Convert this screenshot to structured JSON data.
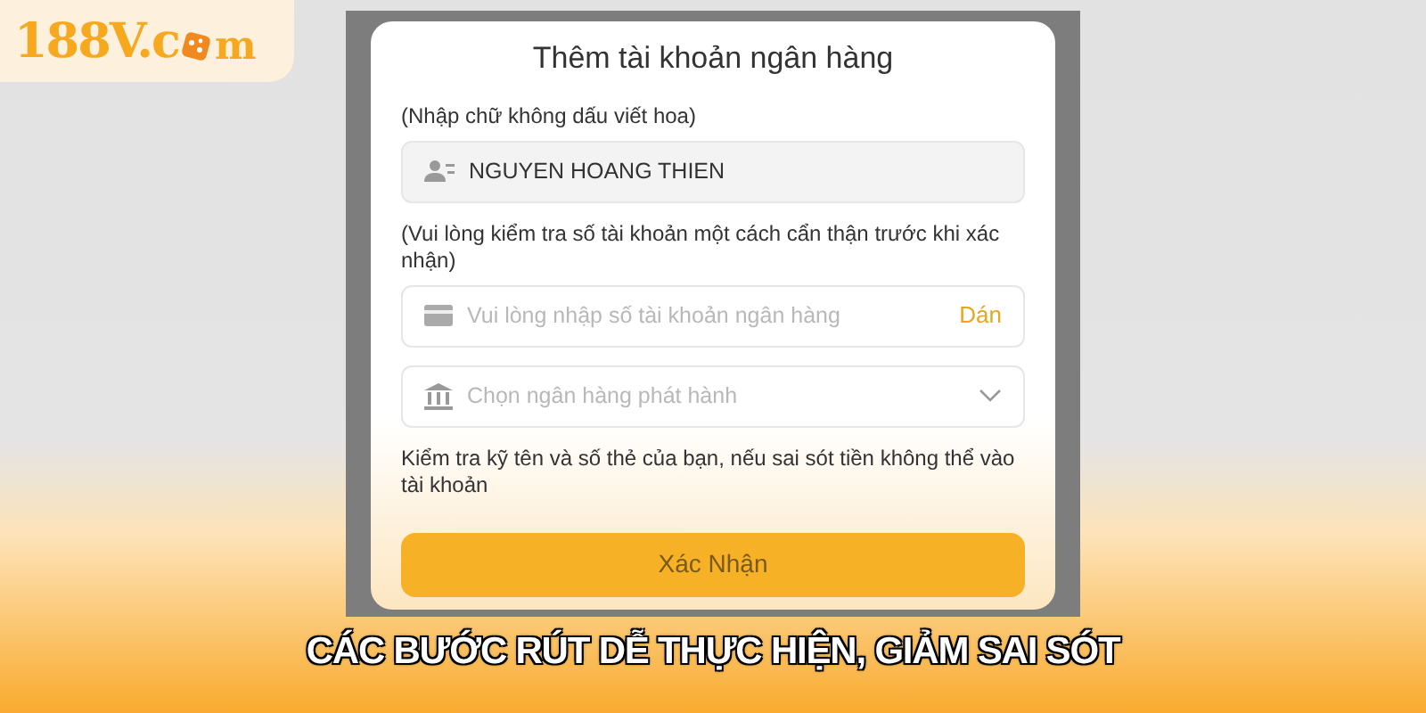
{
  "logo": {
    "text_before": "188V.c",
    "text_after": "m"
  },
  "form": {
    "title": "Thêm tài khoản ngân hàng",
    "fields": [
      {
        "kind": "name",
        "label": "(Nhập chữ không dấu viết hoa)",
        "value": "NGUYEN HOANG THIEN"
      },
      {
        "kind": "account",
        "label": "(Vui lòng kiểm tra số tài khoản một cách cẩn thận trước khi xác nhận)",
        "placeholder": "Vui lòng nhập số tài khoản ngân hàng",
        "action": "Dán"
      },
      {
        "kind": "bank",
        "placeholder": "Chọn ngân hàng phát hành"
      }
    ],
    "warning": "Kiểm tra kỹ tên và số thẻ của bạn, nếu sai sót tiền không thể vào tài khoản",
    "submit": "Xác Nhận"
  },
  "caption": "CÁC BƯỚC RÚT DỄ THỰC HIỆN, GIẢM SAI SÓT"
}
